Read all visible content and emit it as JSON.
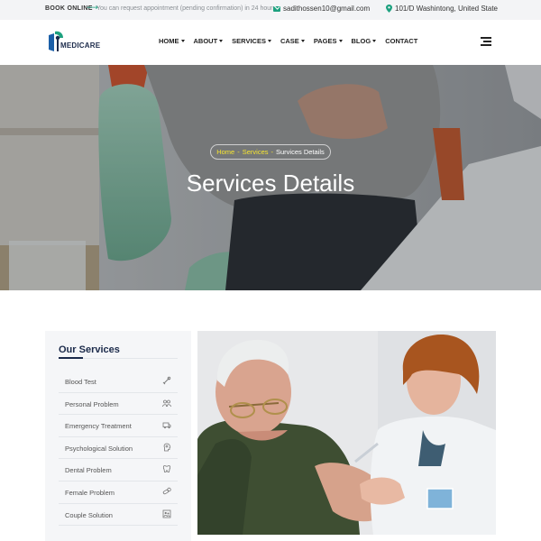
{
  "topbar": {
    "book_online": "BOOK ONLINE",
    "appointment_text": "You can request appointment (pending confirmation) in 24 hours",
    "email": "sadithossen10@gmail.com",
    "address": "101/D Washintong, United State",
    "accent_color": "#1da17f"
  },
  "header": {
    "logo_text": "MEDICARE",
    "nav": [
      {
        "label": "HOME",
        "has_dropdown": true
      },
      {
        "label": "ABOUT",
        "has_dropdown": true
      },
      {
        "label": "SERVICES",
        "has_dropdown": true
      },
      {
        "label": "CASE",
        "has_dropdown": true
      },
      {
        "label": "PAGES",
        "has_dropdown": true
      },
      {
        "label": "BLOG",
        "has_dropdown": true
      },
      {
        "label": "CONTACT",
        "has_dropdown": false
      }
    ],
    "menu_icon": "hamburger-menu-icon"
  },
  "hero": {
    "breadcrumb": {
      "home": "Home",
      "sep": "-",
      "services": "Services",
      "current": "Survices Details"
    },
    "title": "Services Details",
    "breadcrumb_link_color": "#f5e431"
  },
  "sidebar": {
    "title": "Our Services",
    "items": [
      {
        "label": "Blood Test",
        "icon": "blood-test-icon"
      },
      {
        "label": "Personal Problem",
        "icon": "people-icon"
      },
      {
        "label": "Emergency Treatment",
        "icon": "ambulance-icon"
      },
      {
        "label": "Psychological Solution",
        "icon": "head-icon"
      },
      {
        "label": "Dental Problem",
        "icon": "tooth-icon"
      },
      {
        "label": "Female Problem",
        "icon": "pills-icon"
      },
      {
        "label": "Couple Solution",
        "icon": "couple-icon"
      }
    ]
  },
  "main": {
    "image": "doctor-vaccinating-senior-patient"
  }
}
